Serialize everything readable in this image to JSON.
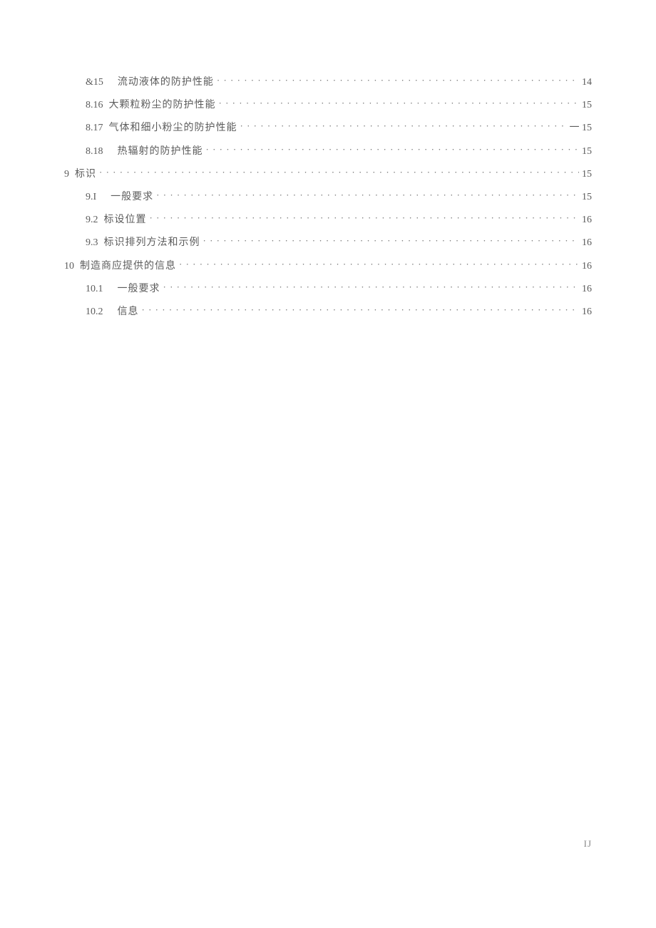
{
  "toc": [
    {
      "num": "&15",
      "title": "流动液体的防护性能",
      "page": "14",
      "level": 2,
      "extra_gap": true
    },
    {
      "num": "8.16",
      "title": "大颗粒粉尘的防护性能",
      "page": "15",
      "level": 2,
      "extra_gap": false
    },
    {
      "num": "8.17",
      "title": "气体和细小粉尘的防护性能",
      "page": "一 15",
      "level": 2,
      "extra_gap": false
    },
    {
      "num": "8.18",
      "title": "热辐射的防护性能",
      "page": "15",
      "level": 2,
      "extra_gap": true
    },
    {
      "num": "9",
      "title": "标识",
      "page": "15",
      "level": 1,
      "extra_gap": false
    },
    {
      "num": "9.I",
      "title": "一般要求",
      "page": "15",
      "level": 2,
      "extra_gap": true
    },
    {
      "num": "9.2",
      "title": "标设位置",
      "page": "16",
      "level": 2,
      "extra_gap": false
    },
    {
      "num": "9.3",
      "title": "标识排列方法和示例",
      "page": "16",
      "level": 2,
      "extra_gap": false
    },
    {
      "num": "10",
      "title": "制造商应提供的信息",
      "page": "16",
      "level": 1,
      "extra_gap": false
    },
    {
      "num": "10.1",
      "title": "一般要求",
      "page": "16",
      "level": 2,
      "extra_gap": true
    },
    {
      "num": "10.2",
      "title": "信息",
      "page": "16",
      "level": 2,
      "extra_gap": true
    }
  ],
  "page_label": "IJ"
}
